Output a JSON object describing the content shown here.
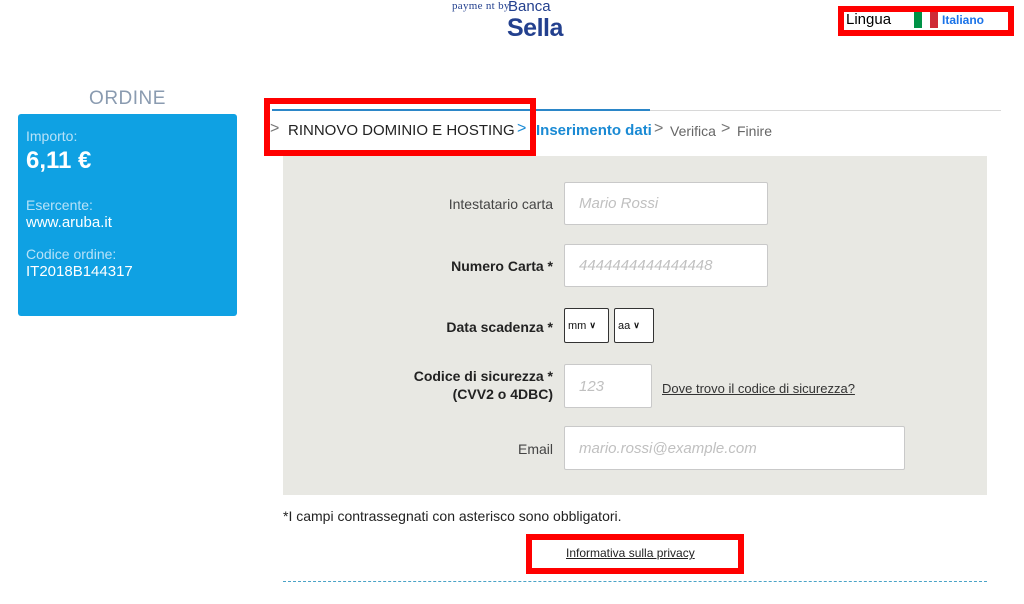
{
  "header": {
    "payment_by": "payme nt by",
    "brand_banca": "Banca",
    "brand_sella": "Sella"
  },
  "language": {
    "label": "Lingua",
    "value": "Italiano",
    "flag_colors": [
      "#009246",
      "#ffffff",
      "#ce2b37"
    ]
  },
  "order": {
    "title": "ORDINE",
    "amount_label": "Importo:",
    "amount": "6,11 €",
    "merchant_label": "Esercente:",
    "merchant": "www.aruba.it",
    "code_label": "Codice ordine:",
    "code": "IT2018B144317"
  },
  "steps": [
    {
      "label": "RINNOVO DOMINIO E HOSTING"
    },
    {
      "label": "Inserimento dati"
    },
    {
      "label": "Verifica"
    },
    {
      "label": "Finire"
    }
  ],
  "form": {
    "holder_label": "Intestatario carta",
    "holder_placeholder": "Mario Rossi",
    "card_label": "Numero Carta *",
    "card_placeholder": "4444444444444448",
    "expiry_label": "Data scadenza *",
    "month_value": "mm",
    "year_value": "aa",
    "cvv_label_line1": "Codice di sicurezza *",
    "cvv_label_line2": "(CVV2 o 4DBC)",
    "cvv_placeholder": "123",
    "cvv_help_link": "Dove trovo il codice di sicurezza?",
    "email_label": "Email",
    "email_placeholder": "mario.rossi@example.com"
  },
  "footer": {
    "required_note": "*I campi contrassegnati con asterisco sono obbligatori.",
    "privacy_link": "Informativa sulla privacy"
  },
  "colors": {
    "accent": "#0fa1e3",
    "active_step": "#1a8ad4",
    "highlight": "#ff0000"
  }
}
